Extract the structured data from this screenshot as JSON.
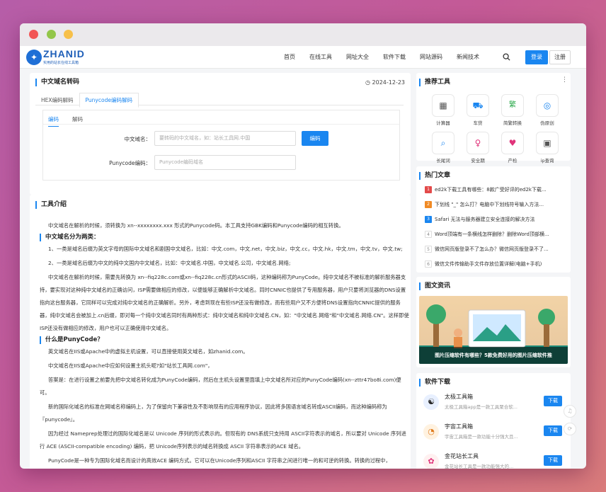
{
  "nav": {
    "logo_text": "ZHANID",
    "logo_sub": "实用的站长在线工具箱",
    "menu": [
      "首页",
      "在线工具",
      "网址大全",
      "软件下载",
      "网站源码",
      "新闻技术"
    ],
    "login": "登录",
    "register": "注册"
  },
  "tool": {
    "title": "中文域名转码",
    "date": "2024-12-23",
    "tabs": [
      "HEX编码解码",
      "Punycode编码解码"
    ],
    "subtabs": [
      "编码",
      "解码"
    ],
    "label_cn": "中文域名：",
    "placeholder_cn": "要转码的中文域名，如：站长工具网.中国",
    "encode_btn": "编码",
    "label_puny": "Punycode编码：",
    "placeholder_puny": "Punycode编码域名"
  },
  "intro": {
    "title": "工具介绍",
    "p1": "中文域名在解析的时候，须转换为 xn--xxxxxxxx.xxx 形式的Punycode码。本工具支持GBK编码和Punycode编码的相互转换。",
    "h1": "中文域名分为两类：",
    "p2": "1、一类是域名后缀为英文字母的国际中文域名和剧国中文域名，比如：中文.com，中文.net，中文.biz，中文.cc，中文.hk，中文.tm，中文.tv，中文.tw;",
    "p3": "2、一类是域名后缀为中文的纯中文国内中文域名，比如：中文域名.中国，中文域名.公司，中文域名.网络;",
    "p4": "中文域名在解析的时候，需要先转换为 xn--fiq228c.com或xn--fiq228c.cn形式的ASCII码，这种编码称为PunyCode。纯中文域名不被标准的解析服务器支持，要实现对这种纯中文域名的正确访问，ISP需要做相应的修改，以便能够正确解析中文域名。同时CNNIC也提供了专用服务器，用户只要将浏览器的DNS设置指向这台服务器，它同样可以完成对纯中文域名的正确解析。另外，考虑到现在有些ISP还没有做修改，而有些用户又不方便将DNS设置指向CNNIC提供的服务器，纯中文域名会被加上.cn后缀，即对每一个纯中文域名同时有两种形式：纯中文域名和纯中文域名.CN，如：\"中文域名.网络\"和\"中文域名.网络.CN\"。这样即使ISP还没有做相应的修改，用户也可以正确使用中文域名。",
    "h2": "什么是PunyCode？",
    "p5": "英文域名在IIS或Apache中的虚拟主机设置，可以直接使用英文域名，如zhanid.com。",
    "p6": "中文域名在IIS或Apache中应如何设置主机头呢?如\"站长工具网.com\"，",
    "p7": "答案是：在进行设置之前要先把中文域名转化成为PunyCode编码，然后在主机头设置里面填上中文域名所对应的PunyCode编码(xn--zttr47bo8i.com)便可。",
    "p8": "新的国际化域名的标准在网域名称编码上，为了保留向下兼容性及不影响现有的应用程序协议，因此将多国语言域名转成ASCII编码，而这种编码称为『punycode』。",
    "p9": "因为经过 Nameprep处理过的国际化域名是以 Unicode 序列的形式表示的。但现有的 DNS系统只支持用 ASCII字符表示的域名，所以要对 Unicode 序列进行 ACE (ASCII-compatible encoding) 编码，把 Unicode序列表示的域名转换成 ASCII 字符串表示的ACE 域名。",
    "p10": "PunyCode是一种专为国际化域名而设计的高效ACE 编码方式。它可以在Unicode序列和ASCII 字符串之间进行唯一的和可逆的转换。转换的过程中，Unicode 序列中的ASCII字符保持不变，国际化字符则用字母和数字来表示。它的实质是一种用数量有限的基本字符(字母和数字)来唯一地表"
  },
  "recommend": {
    "title": "推荐工具",
    "items": [
      {
        "name": "计算器",
        "icon": "calculator-icon",
        "glyph": "▦",
        "color": "#555"
      },
      {
        "name": "车贷",
        "icon": "car-icon",
        "glyph": "🚗",
        "color": "#1a86f0"
      },
      {
        "name": "简繁转换",
        "icon": "translate-icon",
        "glyph": "繁",
        "color": "#2aa84a"
      },
      {
        "name": "伪原创",
        "icon": "rewrite-icon",
        "glyph": "◎",
        "color": "#1a86f0"
      },
      {
        "name": "长尾词",
        "icon": "keyword-icon",
        "glyph": "⌕",
        "color": "#1a86f0"
      },
      {
        "name": "安全期",
        "icon": "calendar-icon",
        "glyph": "♀",
        "color": "#e0337a"
      },
      {
        "name": "产检",
        "icon": "checkup-icon",
        "glyph": "♥",
        "color": "#e0337a"
      },
      {
        "name": "ip查询",
        "icon": "ip-icon",
        "glyph": "▣",
        "color": "#555"
      }
    ]
  },
  "hot": {
    "title": "热门文章",
    "items": [
      "ed2k下载工具有哪些：8款广受好评的ed2k下载...",
      "下划线 \"_\" 怎么打？电脑中下划线符号输入方法...",
      "Safari 无法与服务器建立安全连接的解决方法",
      "Word顶端有一条横线怎样删除？删除Word顶部横...",
      "微信网页版登录不了怎么办？微信网页版登录不了...",
      "微信文件传输助手文件存放位置详解(电脑+手机)"
    ]
  },
  "news": {
    "title": "图文资讯",
    "caption": "图片压缩软件有哪些？5款免费好用的图片压缩软件推"
  },
  "software": {
    "title": "软件下载",
    "download": "下载",
    "items": [
      {
        "name": "太极工具箱",
        "desc": "太极工具箱app是一款工具聚合软...",
        "icon": "taiji-icon",
        "glyph": "☯",
        "color": "#e8f0ff"
      },
      {
        "name": "宇宙工具箱",
        "desc": "宇宙工具箱是一款功能十分强大且...",
        "icon": "universe-icon",
        "glyph": "◔",
        "color": "#fff2e0"
      },
      {
        "name": "金花站长工具",
        "desc": "金花站长工具是一款功能强大的...",
        "icon": "jinhua-icon",
        "glyph": "✿",
        "color": "#fff0f0"
      }
    ]
  }
}
